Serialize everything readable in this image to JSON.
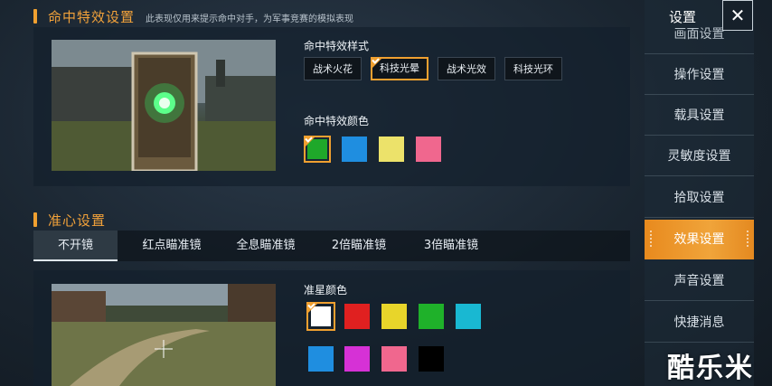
{
  "hit_effect": {
    "title": "命中特效设置",
    "note": "此表现仅用来提示命中对手，为军事竞赛的模拟表现",
    "style_label": "命中特效样式",
    "styles": [
      "战术火花",
      "科技光晕",
      "战术光效",
      "科技光环"
    ],
    "selected_style": 1,
    "color_label": "命中特效颜色",
    "colors": [
      "#1fa82a",
      "#1f8ee0",
      "#ece26a",
      "#f0678e"
    ],
    "selected_color": 0
  },
  "crosshair": {
    "title": "准心设置",
    "tabs": [
      "不开镜",
      "红点瞄准镜",
      "全息瞄准镜",
      "2倍瞄准镜",
      "3倍瞄准镜"
    ],
    "active_tab": 0,
    "color_label": "准星颜色",
    "colors": [
      "#ffffff",
      "#e02020",
      "#e8d52a",
      "#1fb12a",
      "#19b8d2",
      "#1f8ee0",
      "#d631d6",
      "#f0678e",
      "#000000"
    ],
    "selected_color": 0
  },
  "sidebar": {
    "title": "设置",
    "items": [
      "画面设置",
      "操作设置",
      "载具设置",
      "灵敏度设置",
      "拾取设置",
      "效果设置",
      "声音设置",
      "快捷消息"
    ],
    "active_index": 5
  },
  "watermark": "酷乐米",
  "accent_color": "#f0a030"
}
